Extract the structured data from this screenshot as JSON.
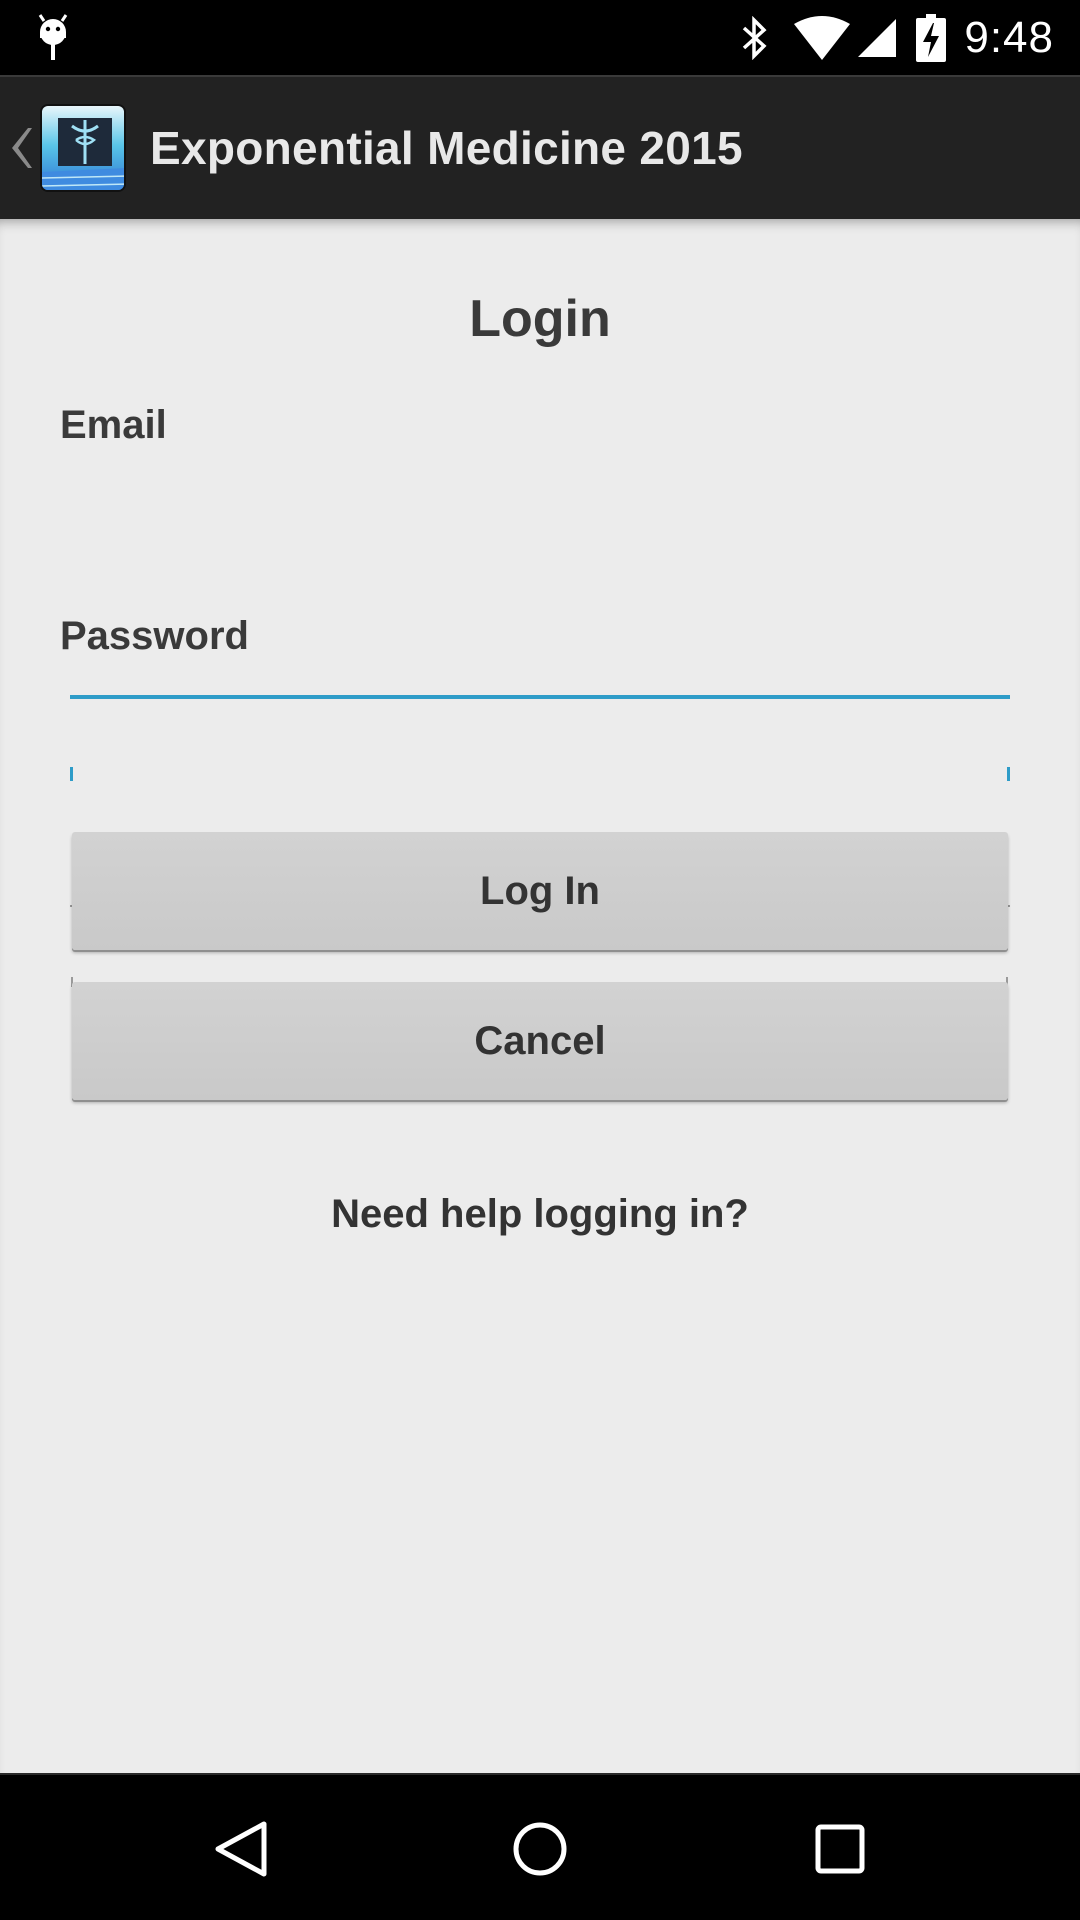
{
  "status_bar": {
    "time": "9:48",
    "icons": [
      "android-debug-icon",
      "bluetooth-icon",
      "wifi-icon",
      "cell-signal-icon",
      "battery-charging-icon"
    ]
  },
  "action_bar": {
    "title": "Exponential Medicine 2015",
    "icons": [
      "back-chevron-icon",
      "app-logo-icon"
    ]
  },
  "login": {
    "heading": "Login",
    "email_label": "Email",
    "email_value": "",
    "password_label": "Password",
    "password_value": "",
    "login_button": "Log In",
    "cancel_button": "Cancel",
    "help_link": "Need help logging in?"
  },
  "colors": {
    "focus_accent": "#2e9cc8",
    "action_bar_bg": "#222222",
    "content_bg": "#ececec"
  },
  "nav_bar": {
    "icons": [
      "nav-back-icon",
      "nav-home-icon",
      "nav-recents-icon"
    ]
  }
}
